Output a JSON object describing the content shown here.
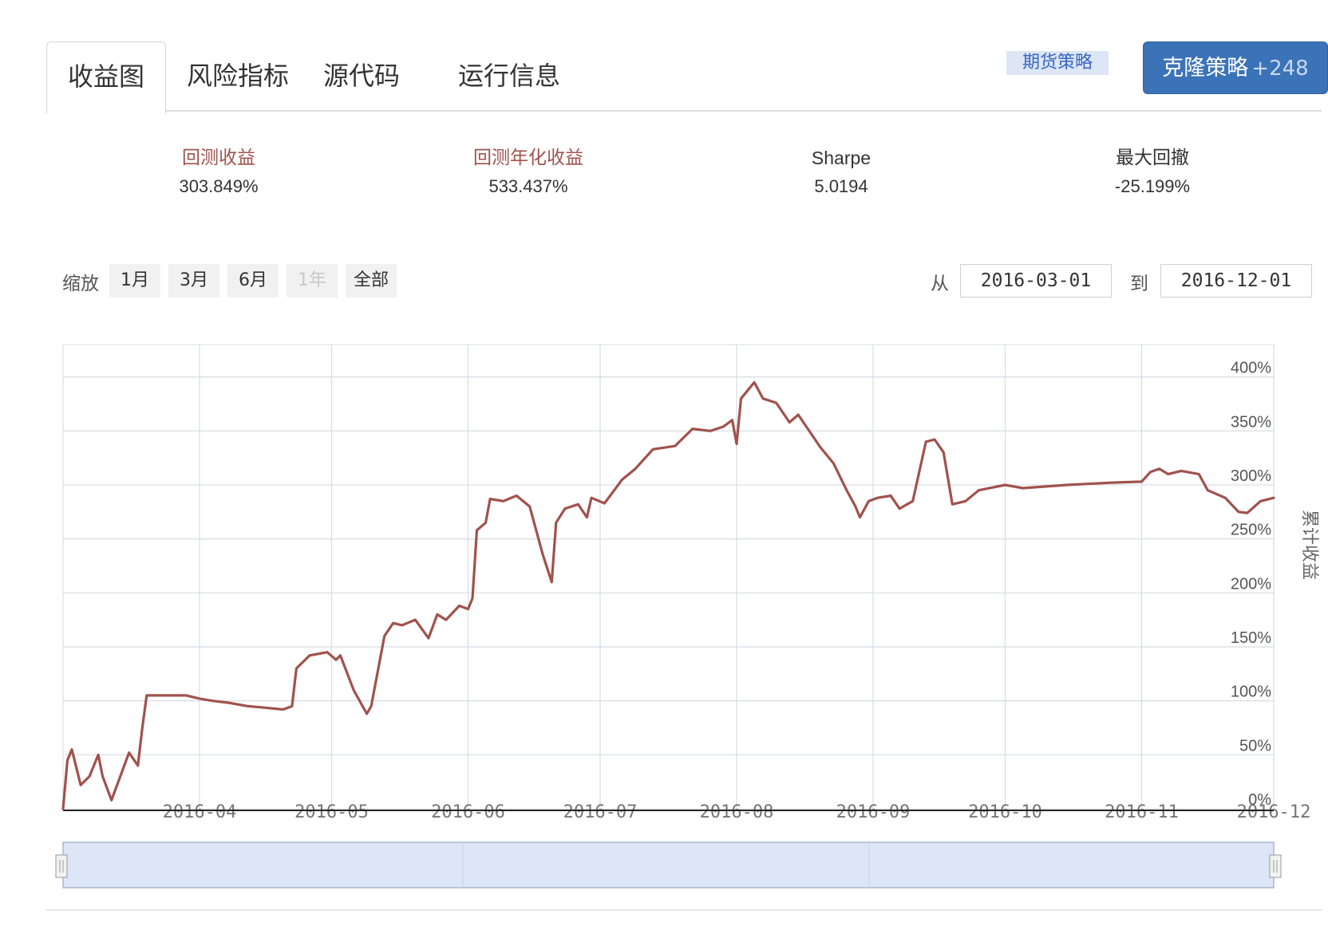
{
  "tabs": [
    {
      "label": "收益图",
      "active": true
    },
    {
      "label": "风险指标",
      "active": false
    },
    {
      "label": "源代码",
      "active": false
    },
    {
      "label": "运行信息",
      "active": false
    }
  ],
  "tag": "期货策略",
  "clone_button": {
    "label": "克隆策略",
    "count": "+248"
  },
  "stats": [
    {
      "label": "回测收益",
      "value": "303.849%"
    },
    {
      "label": "回测年化收益",
      "value": "533.437%"
    },
    {
      "label": "Sharpe",
      "value": "5.0194"
    },
    {
      "label": "最大回撤",
      "value": "-25.199%"
    }
  ],
  "range_selector": {
    "zoom_label": "缩放",
    "buttons": [
      {
        "label": "1月",
        "enabled": true
      },
      {
        "label": "3月",
        "enabled": true
      },
      {
        "label": "6月",
        "enabled": true
      },
      {
        "label": "1年",
        "enabled": false
      },
      {
        "label": "全部",
        "enabled": true
      }
    ],
    "from_label": "从",
    "from_value": "2016-03-01",
    "to_label": "到",
    "to_value": "2016-12-01"
  },
  "colors": {
    "line": "#a0524d",
    "grid": "#d8dbe3",
    "navigator": "#dce6f7"
  },
  "chart_data": {
    "type": "line",
    "x_range": [
      "2016-03-01",
      "2016-12-01"
    ],
    "ylim": [
      0,
      430
    ],
    "ylabel": "累计收益",
    "y_ticks": [
      "0%",
      "50%",
      "100%",
      "150%",
      "200%",
      "250%",
      "300%",
      "350%",
      "400%"
    ],
    "x_ticks": [
      "2016-04",
      "2016-05",
      "2016-06",
      "2016-07",
      "2016-08",
      "2016-09",
      "2016-10",
      "2016-11",
      "2016-12"
    ],
    "grid": true,
    "series": [
      {
        "points": [
          [
            "2016-03-01",
            0
          ],
          [
            "2016-03-02",
            45
          ],
          [
            "2016-03-03",
            55
          ],
          [
            "2016-03-05",
            22
          ],
          [
            "2016-03-07",
            30
          ],
          [
            "2016-03-09",
            50
          ],
          [
            "2016-03-10",
            30
          ],
          [
            "2016-03-12",
            8
          ],
          [
            "2016-03-14",
            30
          ],
          [
            "2016-03-16",
            52
          ],
          [
            "2016-03-18",
            40
          ],
          [
            "2016-03-19",
            75
          ],
          [
            "2016-03-20",
            105
          ],
          [
            "2016-03-22",
            105
          ],
          [
            "2016-03-29",
            105
          ],
          [
            "2016-04-01",
            102
          ],
          [
            "2016-04-04",
            100
          ],
          [
            "2016-04-08",
            98
          ],
          [
            "2016-04-12",
            95
          ],
          [
            "2016-04-15",
            94
          ],
          [
            "2016-04-20",
            92
          ],
          [
            "2016-04-22",
            95
          ],
          [
            "2016-04-23",
            130
          ],
          [
            "2016-04-26",
            142
          ],
          [
            "2016-04-30",
            145
          ],
          [
            "2016-05-02",
            138
          ],
          [
            "2016-05-03",
            142
          ],
          [
            "2016-05-06",
            110
          ],
          [
            "2016-05-09",
            88
          ],
          [
            "2016-05-10",
            95
          ],
          [
            "2016-05-13",
            160
          ],
          [
            "2016-05-15",
            172
          ],
          [
            "2016-05-17",
            170
          ],
          [
            "2016-05-20",
            175
          ],
          [
            "2016-05-23",
            158
          ],
          [
            "2016-05-25",
            180
          ],
          [
            "2016-05-27",
            175
          ],
          [
            "2016-05-30",
            188
          ],
          [
            "2016-06-01",
            185
          ],
          [
            "2016-06-02",
            195
          ],
          [
            "2016-06-03",
            258
          ],
          [
            "2016-06-05",
            265
          ],
          [
            "2016-06-06",
            287
          ],
          [
            "2016-06-09",
            285
          ],
          [
            "2016-06-12",
            290
          ],
          [
            "2016-06-15",
            280
          ],
          [
            "2016-06-18",
            235
          ],
          [
            "2016-06-20",
            210
          ],
          [
            "2016-06-21",
            265
          ],
          [
            "2016-06-23",
            278
          ],
          [
            "2016-06-26",
            282
          ],
          [
            "2016-06-28",
            270
          ],
          [
            "2016-06-29",
            288
          ],
          [
            "2016-07-02",
            283
          ],
          [
            "2016-07-06",
            305
          ],
          [
            "2016-07-09",
            315
          ],
          [
            "2016-07-13",
            333
          ],
          [
            "2016-07-18",
            336
          ],
          [
            "2016-07-22",
            352
          ],
          [
            "2016-07-26",
            350
          ],
          [
            "2016-07-29",
            354
          ],
          [
            "2016-07-31",
            360
          ],
          [
            "2016-08-01",
            338
          ],
          [
            "2016-08-02",
            380
          ],
          [
            "2016-08-05",
            395
          ],
          [
            "2016-08-07",
            380
          ],
          [
            "2016-08-10",
            376
          ],
          [
            "2016-08-13",
            358
          ],
          [
            "2016-08-15",
            365
          ],
          [
            "2016-08-20",
            335
          ],
          [
            "2016-08-23",
            320
          ],
          [
            "2016-08-26",
            295
          ],
          [
            "2016-08-28",
            280
          ],
          [
            "2016-08-29",
            270
          ],
          [
            "2016-08-31",
            285
          ],
          [
            "2016-09-02",
            288
          ],
          [
            "2016-09-05",
            290
          ],
          [
            "2016-09-07",
            278
          ],
          [
            "2016-09-10",
            285
          ],
          [
            "2016-09-13",
            340
          ],
          [
            "2016-09-15",
            342
          ],
          [
            "2016-09-17",
            330
          ],
          [
            "2016-09-19",
            282
          ],
          [
            "2016-09-22",
            285
          ],
          [
            "2016-09-25",
            295
          ],
          [
            "2016-10-01",
            300
          ],
          [
            "2016-10-05",
            297
          ],
          [
            "2016-10-15",
            300
          ],
          [
            "2016-10-25",
            302
          ],
          [
            "2016-11-01",
            303
          ],
          [
            "2016-11-03",
            312
          ],
          [
            "2016-11-05",
            315
          ],
          [
            "2016-11-07",
            310
          ],
          [
            "2016-11-10",
            313
          ],
          [
            "2016-11-14",
            310
          ],
          [
            "2016-11-16",
            295
          ],
          [
            "2016-11-20",
            288
          ],
          [
            "2016-11-23",
            275
          ],
          [
            "2016-11-25",
            274
          ],
          [
            "2016-11-28",
            285
          ],
          [
            "2016-12-01",
            288
          ]
        ]
      }
    ]
  }
}
